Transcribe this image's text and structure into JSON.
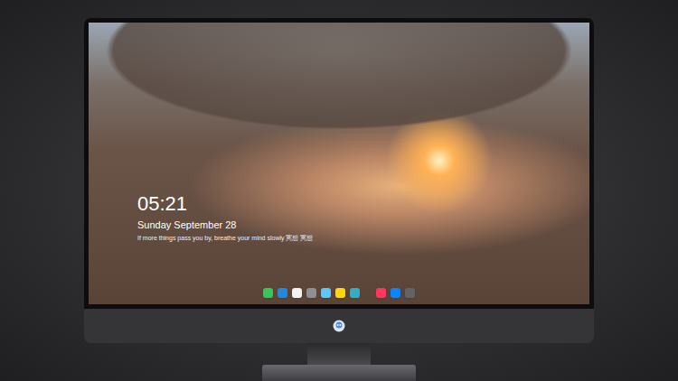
{
  "screen": {
    "clock": "05:21",
    "date": "Sunday September 28",
    "quote": "If more things pass you by, breathe your mind slowly 冥想 冥想"
  },
  "dock": {
    "groups": [
      [
        {
          "app": "messages",
          "color": "#34c759"
        },
        {
          "app": "finder",
          "color": "#1e88e5"
        },
        {
          "app": "clock",
          "color": "#f2f2f2"
        },
        {
          "app": "settings",
          "color": "#8e8e93"
        },
        {
          "app": "video",
          "color": "#5ac8fa"
        },
        {
          "app": "notes",
          "color": "#ffd60a"
        },
        {
          "app": "photos",
          "color": "#30b0c7"
        }
      ],
      [
        {
          "app": "music",
          "color": "#ff375f"
        },
        {
          "app": "store",
          "color": "#0a84ff"
        },
        {
          "app": "camera",
          "color": "#636366"
        }
      ]
    ]
  }
}
